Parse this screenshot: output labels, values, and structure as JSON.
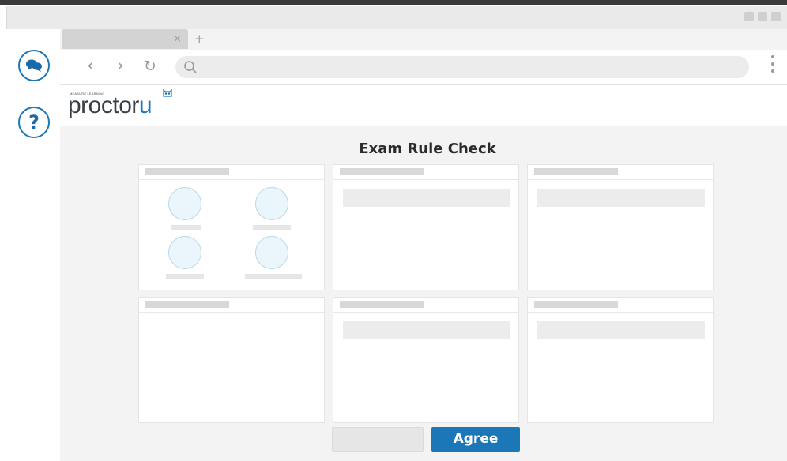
{
  "brand": {
    "tagline": "MEASURE LEARNING",
    "logo_text_main": "proctor",
    "logo_text_accent": "u"
  },
  "page": {
    "title": "Exam Rule Check"
  },
  "actions": {
    "agree_label": "Agree"
  },
  "browser": {
    "tab_close": "×",
    "tab_new": "+",
    "back": "‹",
    "forward": "›",
    "reload": "↻"
  },
  "help": {
    "question_mark": "?"
  },
  "colors": {
    "accent": "#1c77b9",
    "avatar_fill": "#eaf6fb",
    "avatar_stroke": "#b8d9e6"
  },
  "icons": {
    "chat": "chat-bubbles-icon",
    "help": "question-icon",
    "search": "search-icon",
    "menu": "kebab-menu-icon",
    "owl": "owl-icon"
  }
}
